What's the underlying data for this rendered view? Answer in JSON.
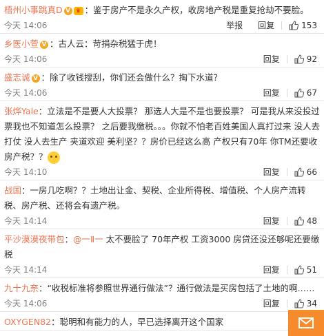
{
  "comments": [
    {
      "user": "梧州小事跳真D",
      "badges": [
        "v",
        "vip"
      ],
      "text": "鉴于房产不是永久产权，收房地产税是重复抢劫不要脸。",
      "time": "今天 14:06",
      "actions": [
        "举报",
        "回复"
      ],
      "likes": "153"
    },
    {
      "user": "乡医小萱",
      "badges": [
        "v"
      ],
      "text": "古人云：苛捐杂税猛于虎！",
      "time": "今天 14:06",
      "actions": [
        "回复"
      ],
      "likes": "92"
    },
    {
      "user": "盛志诚",
      "badges": [
        "v"
      ],
      "text": "除了收钱搜刮，你们还会做什么？掏下水道？",
      "time": "今天 14:06",
      "actions": [
        "回复"
      ],
      "likes": "67"
    },
    {
      "user": "张烨Yale",
      "badges": [],
      "text": "立法是不是要人大投票？ 那选人大是不是也要投票？ 可是我从来没投过票我也不知道怎么投票？ 之后要我缴税。。。你就不怕老百姓美国人真打过来 没人去打仗 没人去生产 夹道欢迎 美利坚？？房价已经这么高 产权只有70年 你TM还要收房产税？？",
      "emoji": true,
      "time": "今天 14:10",
      "actions": [
        "回复"
      ],
      "likes": "66"
    },
    {
      "user": "战国",
      "badges": [],
      "text": "一房几吃啊？？土地出让金、契税、企业所得税、增值税、个人房产流转税、房产税、还将会有遗产税。",
      "time": "今天 14:14",
      "actions": [
        "回复"
      ],
      "likes": "48"
    },
    {
      "user": "平沙漠漠夜带包",
      "badges": [],
      "mention": "@一Ⅱ一",
      "text": "太不要脸了 70年产权 工资3000 房贷还没还够呢还要缴税",
      "time": "今天 14:14",
      "actions": [
        "回复"
      ],
      "likes": "51"
    },
    {
      "user": "九十九奈",
      "badges": [],
      "text": "“收税标准将参照世界通行做法”？通行做法是买房包括了土地的啊……",
      "time": "今天 14:06",
      "actions": [
        "回复"
      ],
      "likes": "34"
    },
    {
      "user": "OXYGEN82",
      "badges": [],
      "text": "聪明和有能力的人，早已选择离开这个国家",
      "time": "",
      "actions": [],
      "likes": ""
    }
  ],
  "colors": {
    "username": "#eb7350",
    "meta": "#808080",
    "mail_button": "#f78a2b"
  },
  "icons": {
    "like": "thumbs-up-icon",
    "mail": "mail-icon"
  }
}
